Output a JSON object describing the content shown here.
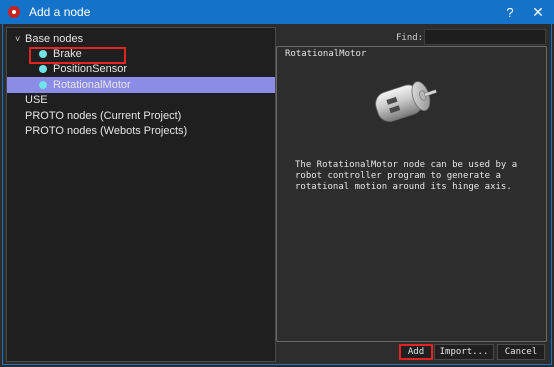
{
  "window": {
    "title": "Add a node",
    "help_label": "?",
    "close_label": "✕"
  },
  "tree": {
    "chevron": "˅",
    "root": {
      "label": "Base nodes"
    },
    "children": [
      {
        "label": "Brake"
      },
      {
        "label": "PositionSensor"
      },
      {
        "label": "RotationalMotor"
      }
    ],
    "others": [
      {
        "label": "USE"
      },
      {
        "label": "PROTO nodes (Current Project)"
      },
      {
        "label": "PROTO nodes (Webots Projects)"
      }
    ]
  },
  "find": {
    "label": "Find:",
    "value": ""
  },
  "info": {
    "title": "RotationalMotor",
    "description": "The RotationalMotor node can be used by a robot controller program to generate a rotational motion around its hinge axis."
  },
  "buttons": {
    "add": "Add",
    "import": "Import...",
    "cancel": "Cancel"
  },
  "colors": {
    "titlebar": "#1473c9",
    "selection": "#8b8be8",
    "highlight": "#e42323",
    "node_dot": "#6fe3e6"
  },
  "icons": {
    "app": "webots-icon",
    "node": "node-dot-icon",
    "motor": "motor-image"
  }
}
